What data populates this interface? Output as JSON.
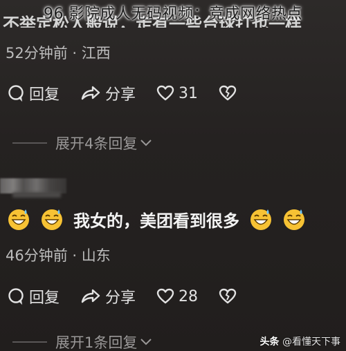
{
  "caption": "96 影院成人无码视频：竞成网络热点",
  "top_comment_fragment": "不举定松人般说，走有一些台球打也一样",
  "comment1": {
    "meta": "52分钟前 · 江西",
    "reply_label": "回复",
    "share_label": "分享",
    "like_count": "31",
    "expand_label": "展开4条回复"
  },
  "comment2": {
    "text": "我女的，美团看到很多",
    "meta": "46分钟前 · 山东",
    "reply_label": "回复",
    "share_label": "分享",
    "like_count": "28",
    "expand_label": "展开1条回复"
  },
  "watermark": {
    "brand": "头条",
    "handle": "@看懂天下事"
  }
}
